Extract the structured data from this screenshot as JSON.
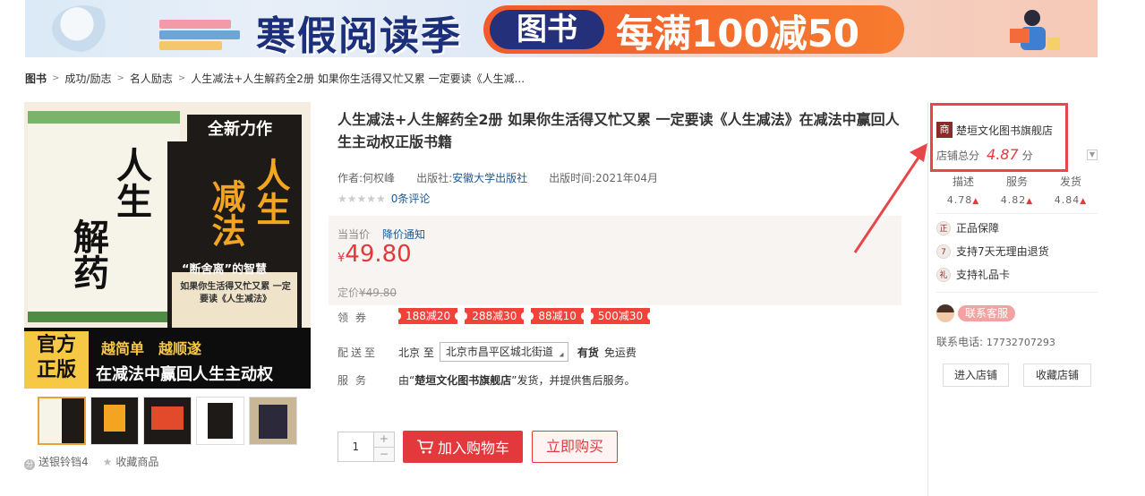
{
  "banner": {
    "title": "寒假阅读季",
    "tag": "图书",
    "promo": "每满100减50"
  },
  "breadcrumb": {
    "root": "图书",
    "items": [
      "成功/励志",
      "名人励志",
      "人生减法+人生解药全2册  如果你生活得又忙又累  一定要读《人生减..."
    ]
  },
  "gallery": {
    "main_cover": {
      "badge": "全新力作",
      "left_title_1": "人生",
      "left_title_2": "解药",
      "right_title_1": "人生",
      "right_title_2": "减法",
      "quote": "“断舍离”的智慧",
      "right_sub": "如果你生活得又忙又累 一定要读《人生减法》",
      "official": "官方正版",
      "slogan_1": "越简单",
      "slogan_2": "越顺遂",
      "slogan_3": "在减法中赢回人生主动权"
    },
    "thumb_count": 5,
    "share_label": "送银铃铛4",
    "favorite_label": "收藏商品"
  },
  "product": {
    "title": "人生减法+人生解药全2册 如果你生活得又忙又累 一定要读《人生减法》在减法中赢回人生主动权正版书籍",
    "author_label": "作者:",
    "author": "何权峰",
    "publisher_label": "出版社:",
    "publisher": "安徽大学出版社",
    "pubdate_label": "出版时间:",
    "pubdate": "2021年04月",
    "stars": "★★★★★",
    "reviews": "0条评论",
    "price_label": "当当价",
    "price_notice": "降价通知",
    "currency": "¥",
    "price": "49.80",
    "orig_label": "定价",
    "orig_price": "¥49.80",
    "coupon_label": "领券",
    "coupons": [
      "188减20",
      "288减30",
      "88减10",
      "500减30"
    ],
    "delivery_label": "配送至",
    "ship_from": "北京 至",
    "address": "北京市昌平区城北街道",
    "stock": "有货",
    "shipping": "免运费",
    "service_label": "服务",
    "service_pre": "由“",
    "service_store": "楚垣文化图书旗舰店",
    "service_post": "”发货，并提供售后服务。",
    "quantity": "1",
    "qty_plus": "+",
    "qty_minus": "−",
    "add_cart": "加入购物车",
    "buy_now": "立即购买"
  },
  "store": {
    "badge": "商",
    "name": "楚垣文化图书旗舰店",
    "score_label": "店铺总分",
    "score": "4.87",
    "score_unit": "分",
    "subscores": [
      {
        "label": "描述",
        "value": "4.78"
      },
      {
        "label": "服务",
        "value": "4.82"
      },
      {
        "label": "发货",
        "value": "4.84"
      }
    ],
    "guarantees": [
      {
        "icon": "正",
        "label": "正品保障"
      },
      {
        "icon": "7",
        "label": "支持7天无理由退货"
      },
      {
        "icon": "礼",
        "label": "支持礼品卡"
      }
    ],
    "contact": "联系客服",
    "phone_label": "联系电话:",
    "phone": "17732707293",
    "enter_store": "进入店铺",
    "fav_store": "收藏店铺"
  },
  "colors": {
    "accent": "#e4393c",
    "link": "#1a5a99",
    "highlight": "#e8474a"
  }
}
